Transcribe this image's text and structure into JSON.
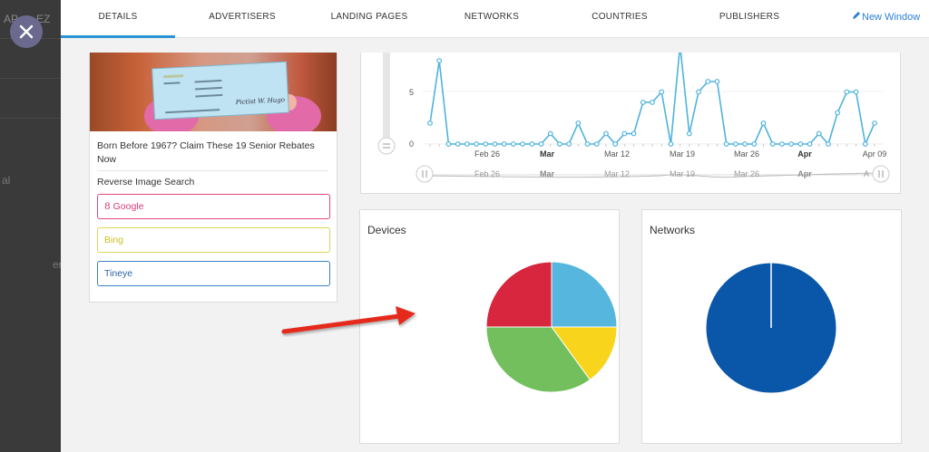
{
  "backdrop": {
    "fragments": [
      "AP",
      "EZ",
      "al",
      "er"
    ]
  },
  "tabs": [
    {
      "label": "DETAILS",
      "active": true
    },
    {
      "label": "ADVERTISERS",
      "active": false
    },
    {
      "label": "LANDING PAGES",
      "active": false
    },
    {
      "label": "NETWORKS",
      "active": false
    },
    {
      "label": "COUNTRIES",
      "active": false
    },
    {
      "label": "PUBLISHERS",
      "active": false
    }
  ],
  "new_window_label": "New Window",
  "ad": {
    "title": "Born Before 1967? Claim These 19 Senior Rebates Now",
    "check_signature": "Pictist W. Hugo",
    "reverse_search_label": "Reverse Image Search",
    "google_label": "Google",
    "google_icon_glyph": "8",
    "bing_label": "Bing",
    "tineye_label": "Tineye"
  },
  "timeline": {
    "y_ticks": [
      "5",
      "0"
    ],
    "x_labels": [
      "Feb 26",
      "Mar",
      "Mar 12",
      "Mar 19",
      "Mar 26",
      "Apr",
      "Apr 09"
    ],
    "nav_labels": [
      "Feb 26",
      "Mar",
      "Mar 12",
      "Mar 19",
      "Mar 26",
      "Apr",
      "A"
    ],
    "series_color": "#4fb3dd",
    "values": [
      2,
      8,
      0,
      0,
      0,
      0,
      0,
      0,
      0,
      0,
      0,
      0,
      0,
      1,
      0,
      0,
      2,
      0,
      0,
      1,
      0,
      1,
      1,
      4,
      4,
      5,
      0,
      12,
      1,
      5,
      6,
      6,
      0,
      0,
      0,
      0,
      2,
      0,
      0,
      0,
      0,
      0,
      1,
      0,
      3,
      5,
      5,
      0,
      2
    ]
  },
  "devices": {
    "title": "Devices",
    "slices": [
      {
        "value": 25,
        "color": "#56b6de"
      },
      {
        "value": 15,
        "color": "#f8d51c"
      },
      {
        "value": 35,
        "color": "#73bf5e"
      },
      {
        "value": 25,
        "color": "#d7263d"
      }
    ]
  },
  "networks": {
    "title": "Networks",
    "slices": [
      {
        "value": 100,
        "color": "#0a56a8"
      }
    ]
  }
}
